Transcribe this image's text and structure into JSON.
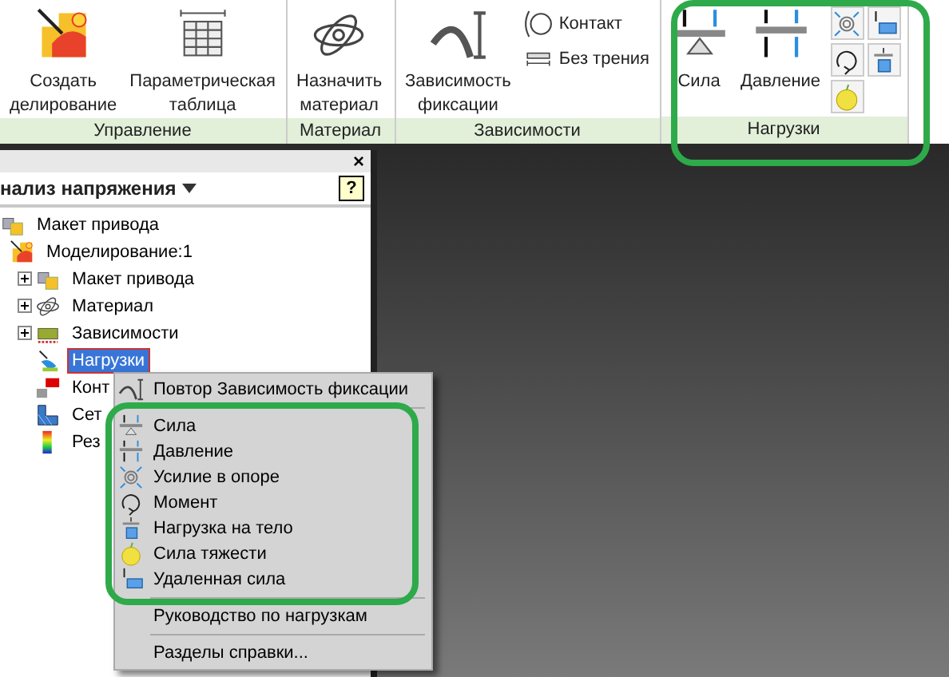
{
  "ribbon": {
    "groups": [
      {
        "title": "Управление",
        "buttons": [
          {
            "kind": "large",
            "label": "Создать\nделирование"
          },
          {
            "kind": "large",
            "label": "Параметрическая\nтаблица"
          }
        ]
      },
      {
        "title": "Материал",
        "buttons": [
          {
            "kind": "large",
            "label": "Назначить\nматериал"
          }
        ]
      },
      {
        "title": "Зависимости",
        "buttons": [
          {
            "kind": "large",
            "label": "Зависимость\nфиксации"
          },
          {
            "kind": "small",
            "label": "Контакт"
          },
          {
            "kind": "small",
            "label": "Без трения"
          }
        ]
      },
      {
        "title": "Нагрузки",
        "buttons": [
          {
            "kind": "large",
            "label": "Сила"
          },
          {
            "kind": "large",
            "label": "Давление"
          },
          {
            "kind": "icon"
          },
          {
            "kind": "icon"
          },
          {
            "kind": "icon"
          },
          {
            "kind": "icon"
          },
          {
            "kind": "icon"
          }
        ]
      }
    ]
  },
  "browser": {
    "title": "нализ напряжения",
    "help": "?",
    "close": "×",
    "tree": [
      {
        "label": "Макет привода",
        "selected": false,
        "children": [
          {
            "label": "Моделирование:1",
            "selected": false,
            "children": [
              {
                "label": "Макет привода",
                "selected": false,
                "expanded": false
              },
              {
                "label": "Материал",
                "selected": false,
                "expanded": false
              },
              {
                "label": "Зависимости",
                "selected": false,
                "expanded": false
              },
              {
                "label": "Нагрузки",
                "selected": true
              },
              {
                "label": "Конт",
                "selected": false
              },
              {
                "label": "Сет",
                "selected": false
              },
              {
                "label": "Рез",
                "selected": false
              }
            ]
          }
        ]
      }
    ]
  },
  "context_menu": {
    "items": [
      {
        "kind": "item",
        "label": "Повтор Зависимость фиксации"
      },
      {
        "kind": "separator"
      },
      {
        "kind": "item",
        "label": "Сила"
      },
      {
        "kind": "item",
        "label": "Давление"
      },
      {
        "kind": "item",
        "label": "Усилие в опоре"
      },
      {
        "kind": "item",
        "label": "Момент"
      },
      {
        "kind": "item",
        "label": "Нагрузка на тело"
      },
      {
        "kind": "item",
        "label": "Сила тяжести"
      },
      {
        "kind": "item",
        "label": "Удаленная сила"
      },
      {
        "kind": "separator"
      },
      {
        "kind": "item",
        "label": "Руководство по нагрузкам"
      },
      {
        "kind": "separator"
      },
      {
        "kind": "item",
        "label": "Разделы справки..."
      }
    ]
  }
}
